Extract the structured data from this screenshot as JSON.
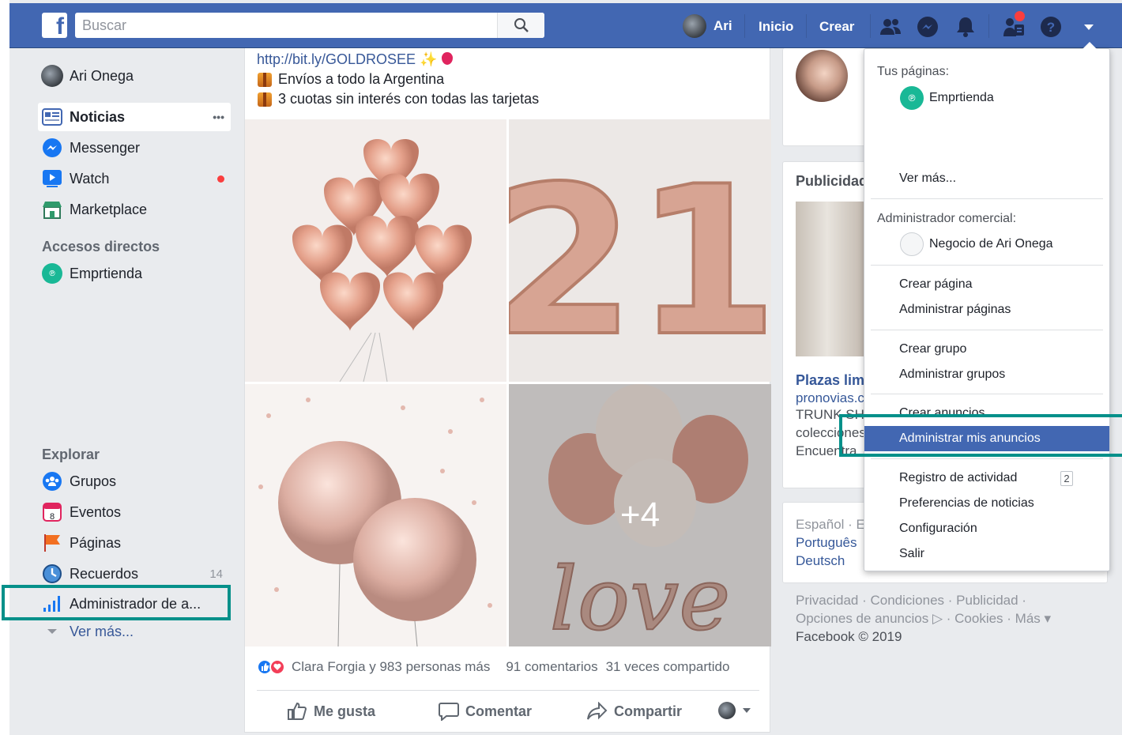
{
  "topbar": {
    "logo": "f",
    "search_placeholder": "Buscar",
    "user_name": "Ari",
    "home_label": "Inicio",
    "create_label": "Crear"
  },
  "sidebar": {
    "profile_name": "Ari Onega",
    "items": [
      {
        "label": "Noticias"
      },
      {
        "label": "Messenger"
      },
      {
        "label": "Watch"
      },
      {
        "label": "Marketplace"
      }
    ],
    "more_dots": "•••",
    "shortcuts_heading": "Accesos directos",
    "shortcut_item": "Emprtienda",
    "explore_heading": "Explorar",
    "explore_items": [
      {
        "label": "Grupos"
      },
      {
        "label": "Eventos",
        "icon_text": "8"
      },
      {
        "label": "Páginas"
      },
      {
        "label": "Recuerdos",
        "count": "14"
      },
      {
        "label": "Administrador de a..."
      }
    ],
    "see_more": "Ver más..."
  },
  "post": {
    "link": "http://bit.ly/GOLDROSEE",
    "line1": "Envíos a todo la Argentina",
    "line2": "3 cuotas sin interés con todas las tarjetas",
    "photo_overlay": "+4",
    "reactions_text": "Clara Forgia y 983 personas más",
    "comments": "91 comentarios",
    "shares": "31 veces compartido",
    "actions": {
      "like": "Me gusta",
      "comment": "Comentar",
      "share": "Compartir"
    }
  },
  "right": {
    "ads_heading": "Publicidad",
    "ad_title": "Plazas limi",
    "ad_domain": "pronovias.c",
    "ad_text1": "TRUNK SH",
    "ad_text2": "colecciones",
    "ad_text3": "Encuentra",
    "lang1": "Español · E",
    "lang2": "Português",
    "lang3": "Deutsch",
    "footer1": "Privacidad · Condiciones · Publicidad ·",
    "footer2": "Opciones de anuncios ▷ · Cookies · Más ▾",
    "footer3": "Facebook © 2019"
  },
  "menu": {
    "pages_label": "Tus páginas:",
    "page_name": "Emprtienda",
    "see_more": "Ver más...",
    "business_label": "Administrador comercial:",
    "business_name": "Negocio de Ari Onega",
    "create_page": "Crear página",
    "manage_pages": "Administrar páginas",
    "create_group": "Crear grupo",
    "manage_groups": "Administrar grupos",
    "create_ads": "Crear anuncios",
    "manage_ads": "Administrar mis anuncios",
    "activity_log": "Registro de actividad",
    "activity_count": "2",
    "news_prefs": "Preferencias de noticias",
    "settings": "Configuración",
    "logout": "Salir"
  },
  "colors": {
    "brand": "#4267b2",
    "highlight": "#05908a"
  }
}
